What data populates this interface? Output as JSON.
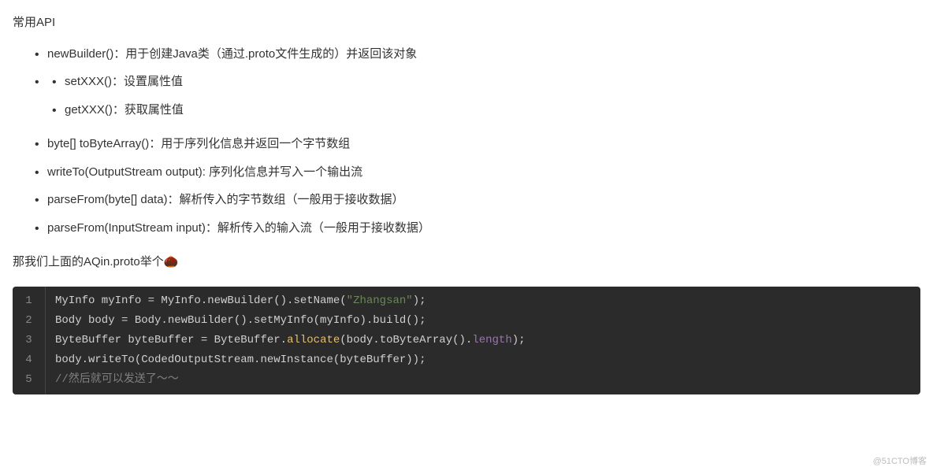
{
  "heading": "常用API",
  "list": {
    "items": [
      {
        "text": "newBuilder()：用于创建Java类（通过.proto文件生成的）并返回该对象"
      },
      {
        "text": "",
        "children": [
          {
            "text": "setXXX()：设置属性值"
          },
          {
            "text": "getXXX()：获取属性值"
          }
        ]
      },
      {
        "text": "byte[] toByteArray()：用于序列化信息并返回一个字节数组"
      },
      {
        "text": "writeTo(OutputStream output): 序列化信息并写入一个输出流"
      },
      {
        "text": "parseFrom(byte[] data)：解析传入的字节数组（一般用于接收数据）"
      },
      {
        "text": "parseFrom(InputStream input)：解析传入的输入流（一般用于接收数据）"
      }
    ]
  },
  "paragraph": "那我们上面的AQin.proto举个🌰",
  "code": {
    "lines": [
      {
        "num": "1",
        "tokens": [
          {
            "t": "MyInfo myInfo = MyInfo.newBuilder().setName(",
            "c": ""
          },
          {
            "t": "\"Zhangsan\"",
            "c": "tok-str"
          },
          {
            "t": ");",
            "c": ""
          }
        ]
      },
      {
        "num": "2",
        "tokens": [
          {
            "t": "Body body = Body.newBuilder().setMyInfo(myInfo).build();",
            "c": ""
          }
        ]
      },
      {
        "num": "3",
        "tokens": [
          {
            "t": "ByteBuffer byteBuffer = ByteBuffer.",
            "c": ""
          },
          {
            "t": "allocate",
            "c": "tok-func"
          },
          {
            "t": "(body.toByteArray().",
            "c": ""
          },
          {
            "t": "length",
            "c": "tok-num-prop"
          },
          {
            "t": ");",
            "c": ""
          }
        ]
      },
      {
        "num": "4",
        "tokens": [
          {
            "t": "body.writeTo(CodedOutputStream.newInstance(byteBuffer));",
            "c": ""
          }
        ]
      },
      {
        "num": "5",
        "tokens": [
          {
            "t": "//然后就可以发送了～～",
            "c": "tok-comment"
          }
        ]
      }
    ]
  },
  "watermark": "@51CTO博客"
}
